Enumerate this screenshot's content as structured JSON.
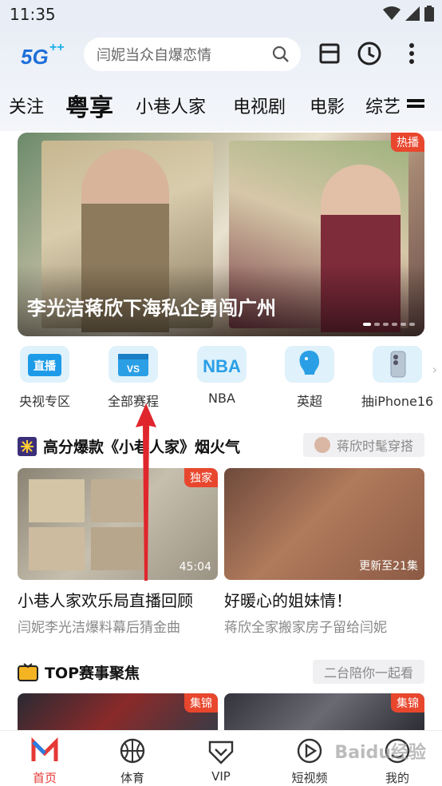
{
  "status_bar": {
    "time": "11:35"
  },
  "header": {
    "logo_text": "5G",
    "search_placeholder": "闫妮当众自爆恋情",
    "tabs": [
      "关注",
      "粤享",
      "小巷人家",
      "电视剧",
      "电影",
      "综艺"
    ]
  },
  "banner": {
    "badge": "热播",
    "caption": "李光洁蒋欣下海私企勇闯广州",
    "dots_count": 6,
    "active_dot": 0
  },
  "categories": [
    {
      "label": "央视专区",
      "icon": "live-tv-icon",
      "icon_text": "直播"
    },
    {
      "label": "全部赛程",
      "icon": "schedule-icon",
      "icon_text": "VS"
    },
    {
      "label": "NBA",
      "icon": "nba-icon",
      "icon_text": "NBA"
    },
    {
      "label": "英超",
      "icon": "premier-league-icon",
      "icon_text": ""
    },
    {
      "label": "抽iPhone16",
      "icon": "iphone-icon",
      "icon_text": ""
    }
  ],
  "section1": {
    "title": "高分爆款《小巷人家》烟火气",
    "button": "蒋欣时髦穿搭",
    "cards": [
      {
        "badge": "独家",
        "duration": "45:04",
        "title": "小巷人家欢乐局直播回顾",
        "subtitle": "闫妮李光洁爆料幕后猜金曲"
      },
      {
        "badge": "",
        "duration": "更新至21集",
        "title": "好暖心的姐妹情！",
        "subtitle": "蒋欣全家搬家房子留给闫妮"
      }
    ]
  },
  "section2": {
    "title": "TOP赛事聚焦",
    "button": "二台陪你一起看",
    "cards": [
      {
        "badge": "集锦"
      },
      {
        "badge": "集锦"
      }
    ]
  },
  "bottom_nav": [
    {
      "label": "首页",
      "icon": "home-icon",
      "active": true
    },
    {
      "label": "体育",
      "icon": "basketball-icon",
      "active": false
    },
    {
      "label": "VIP",
      "icon": "vip-icon",
      "active": false
    },
    {
      "label": "短视频",
      "icon": "play-icon",
      "active": false
    },
    {
      "label": "我的",
      "icon": "profile-icon",
      "active": false
    }
  ],
  "watermark": "Baidu经验",
  "colors": {
    "accent": "#e53935",
    "badge": "#e8472e",
    "header_bg": "#e9eef6"
  }
}
